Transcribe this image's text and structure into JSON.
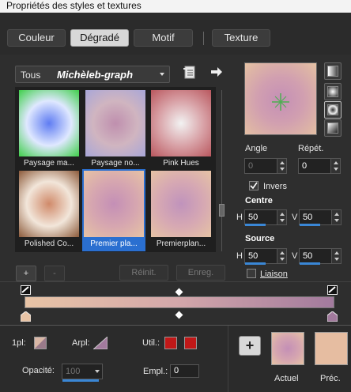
{
  "window": {
    "title": "Propriétés des styles et textures"
  },
  "tabs": [
    "Couleur",
    "Dégradé",
    "Motif",
    "Texture"
  ],
  "active_tab": "Dégradé",
  "library": {
    "category": "Tous",
    "collection": "Michèleb-graph",
    "items": [
      {
        "label": "Paysage ma...",
        "colors": [
          "#5f7cf2",
          "#dfe8ff",
          "#3fcf4a"
        ]
      },
      {
        "label": "Paysage no...",
        "colors": [
          "#bf8fae",
          "#d0b5c0",
          "#a8a6d8"
        ]
      },
      {
        "label": "Pink Hues",
        "colors": [
          "#f2f2f2",
          "#d9a3a8",
          "#b9575e"
        ]
      },
      {
        "label": "Polished Co...",
        "colors": [
          "#d08a6a",
          "#f2e6da",
          "#8c5a3a"
        ]
      },
      {
        "label": "Premier pla...",
        "colors": [
          "#c48fb6",
          "#d6a6b0",
          "#e6c3a4"
        ],
        "selected": true
      },
      {
        "label": "Premierplan...",
        "colors": [
          "#c093bc",
          "#d6a8b3",
          "#e6c3a4"
        ]
      }
    ]
  },
  "buttons": {
    "add": "+",
    "remove": "-",
    "reset": "Réinit.",
    "save": "Enreg."
  },
  "settings": {
    "angle_label": "Angle",
    "angle_value": "0",
    "repeat_label": "Répét.",
    "repeat_value": "0",
    "invert_label": "Invers",
    "invert_checked": true,
    "center_label": "Centre",
    "center_h_label": "H",
    "center_h": "50",
    "center_v_label": "V",
    "center_v": "50",
    "source_label": "Source",
    "source_h_label": "H",
    "source_h": "50",
    "source_v_label": "V",
    "source_v": "50",
    "link_label": "Liaison",
    "link_checked": false
  },
  "gradient": {
    "start_color": "#e8c4a6",
    "mid_color": "#d3a7aa",
    "end_color": "#a27a9d"
  },
  "bottom": {
    "fg_label": "1pl:",
    "bg_label": "Arpl:",
    "util_label": "Util.:",
    "util_colors": [
      "#c01818",
      "#c01818"
    ],
    "opacity_label": "Opacité:",
    "opacity_value": "100",
    "location_label": "Empl.:",
    "location_value": "0",
    "current_label": "Actuel",
    "previous_label": "Préc.",
    "previous_color": "#e6bda1",
    "add_swatch": "+"
  },
  "colors": {
    "accent": "#2a6fd0",
    "bar": "#3a87d6"
  }
}
